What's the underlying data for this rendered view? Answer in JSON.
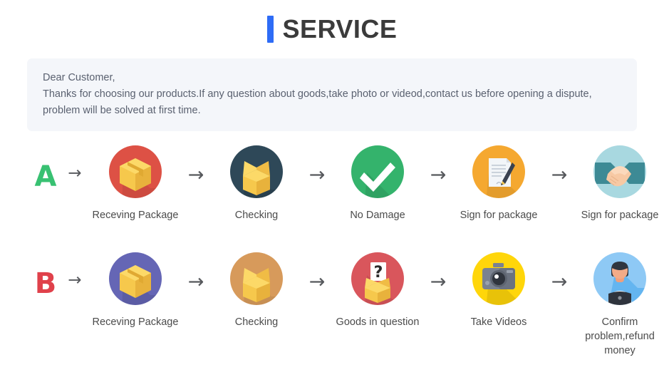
{
  "header": {
    "title": "SERVICE",
    "accent_color": "#2e6cf6"
  },
  "notice": {
    "line1": "Dear Customer,",
    "line2": "Thanks for choosing our products.If any question about goods,take photo or videod,contact us before opening a dispute,",
    "line3": "problem will be solved at first time.",
    "background_color": "#f4f6fa"
  },
  "arrow_glyph": "→",
  "flows": [
    {
      "letter": "A",
      "letter_color": "#38c172",
      "steps": [
        {
          "label": "Receving Package",
          "icon": "package-box-icon",
          "circle_color": "#dd5145"
        },
        {
          "label": "Checking",
          "icon": "open-box-icon",
          "circle_color": "#2e4858"
        },
        {
          "label": "No Damage",
          "icon": "check-mark-icon",
          "circle_color": "#34b36c"
        },
        {
          "label": "Sign for package",
          "icon": "document-pen-icon",
          "circle_color": "#f5a830"
        },
        {
          "label": "Sign for package",
          "icon": "handshake-icon",
          "circle_color": "#a8d8e0"
        }
      ]
    },
    {
      "letter": "B",
      "letter_color": "#e0414b",
      "steps": [
        {
          "label": "Receving Package",
          "icon": "package-box-icon",
          "circle_color": "#6566b5"
        },
        {
          "label": "Checking",
          "icon": "open-box-icon",
          "circle_color": "#d79a5b"
        },
        {
          "label": "Goods in question",
          "icon": "question-box-icon",
          "circle_color": "#d9565c"
        },
        {
          "label": "Take Videos",
          "icon": "camera-icon",
          "circle_color": "#ffd60a"
        },
        {
          "label": "Confirm  problem,refund money",
          "icon": "support-agent-icon",
          "circle_color": "#8ec9f5"
        }
      ]
    }
  ]
}
